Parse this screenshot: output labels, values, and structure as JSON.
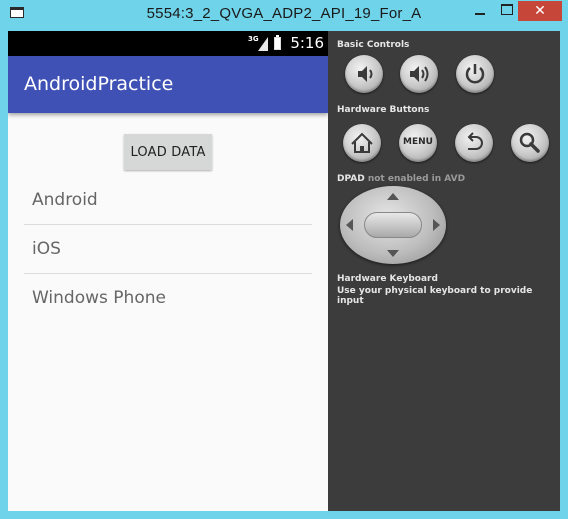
{
  "window": {
    "title": "5554:3_2_QVGA_ADP2_API_19_For_A",
    "minimize_icon": "minimize-icon",
    "maximize_icon": "maximize-icon",
    "close_label": "✕"
  },
  "statusbar": {
    "network": "3G",
    "time": "5:16"
  },
  "app": {
    "title": "AndroidPractice",
    "load_button": "LOAD DATA",
    "list_items": [
      "Android",
      "iOS",
      "Windows Phone"
    ]
  },
  "panel": {
    "basic_controls": "Basic Controls",
    "hardware_buttons": "Hardware Buttons",
    "menu_label": "MENU",
    "dpad_label": "DPAD",
    "dpad_note": "not enabled in AVD",
    "keyboard_title": "Hardware Keyboard",
    "keyboard_note": "Use your physical keyboard to provide input"
  },
  "colors": {
    "window_frame": "#6fd3ea",
    "appbar": "#3f51b5",
    "panel_bg": "#3c3c3c",
    "close_button": "#c7463a"
  }
}
